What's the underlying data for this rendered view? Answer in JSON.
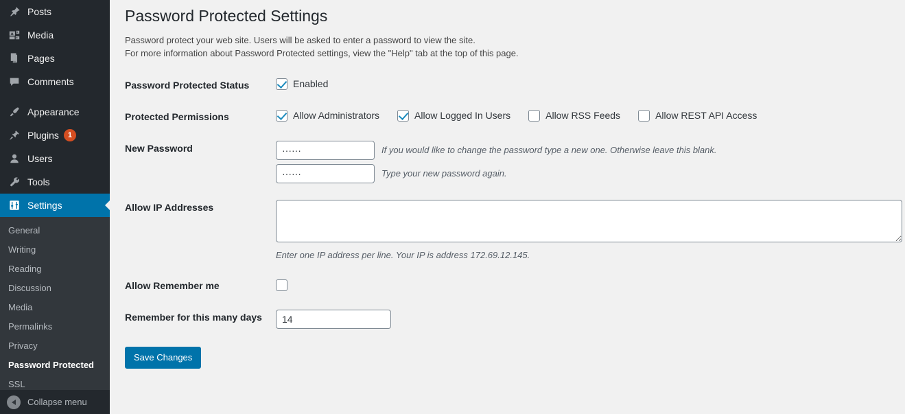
{
  "sidebar": {
    "items": [
      {
        "label": "Posts",
        "icon": "pin-icon",
        "current": false
      },
      {
        "label": "Media",
        "icon": "media-icon",
        "current": false
      },
      {
        "label": "Pages",
        "icon": "pages-icon",
        "current": false
      },
      {
        "label": "Comments",
        "icon": "comments-icon",
        "current": false
      },
      {
        "label": "Appearance",
        "icon": "appearance-brush-icon",
        "current": false
      },
      {
        "label": "Plugins",
        "icon": "plugin-icon",
        "current": false,
        "badge": "1"
      },
      {
        "label": "Users",
        "icon": "user-icon",
        "current": false
      },
      {
        "label": "Tools",
        "icon": "wrench-icon",
        "current": false
      },
      {
        "label": "Settings",
        "icon": "settings-sliders-icon",
        "current": true
      }
    ],
    "submenu": [
      {
        "label": "General",
        "active": false
      },
      {
        "label": "Writing",
        "active": false
      },
      {
        "label": "Reading",
        "active": false
      },
      {
        "label": "Discussion",
        "active": false
      },
      {
        "label": "Media",
        "active": false
      },
      {
        "label": "Permalinks",
        "active": false
      },
      {
        "label": "Privacy",
        "active": false
      },
      {
        "label": "Password Protected",
        "active": true
      },
      {
        "label": "SSL",
        "active": false
      }
    ],
    "collapse_label": "Collapse menu",
    "collapse_icon": "collapse-arrow-icon"
  },
  "page": {
    "title": "Password Protected Settings",
    "intro_line1": "Password protect your web site. Users will be asked to enter a password to view the site.",
    "intro_line2": "For more information about Password Protected settings, view the \"Help\" tab at the top of this page."
  },
  "form": {
    "status": {
      "label": "Password Protected Status",
      "checkbox_label": "Enabled",
      "checked": true
    },
    "permissions": {
      "label": "Protected Permissions",
      "options": [
        {
          "label": "Allow Administrators",
          "checked": true
        },
        {
          "label": "Allow Logged In Users",
          "checked": true
        },
        {
          "label": "Allow RSS Feeds",
          "checked": false
        },
        {
          "label": "Allow REST API Access",
          "checked": false
        }
      ]
    },
    "new_password": {
      "label": "New Password",
      "field1_value": "······",
      "field1_desc": "If you would like to change the password type a new one. Otherwise leave this blank.",
      "field2_value": "······",
      "field2_desc": "Type your new password again."
    },
    "allow_ip": {
      "label": "Allow IP Addresses",
      "value": "",
      "desc": "Enter one IP address per line. Your IP is address 172.69.12.145."
    },
    "allow_remember": {
      "label": "Allow Remember me",
      "checked": false
    },
    "remember_days": {
      "label": "Remember for this many days",
      "value": "14"
    },
    "save_label": "Save Changes"
  },
  "colors": {
    "sidebar_bg": "#23282d",
    "submenu_bg": "#32373c",
    "accent": "#0073aa",
    "badge": "#d54e21",
    "check": "#1e8cbe",
    "page_bg": "#f1f1f1"
  }
}
